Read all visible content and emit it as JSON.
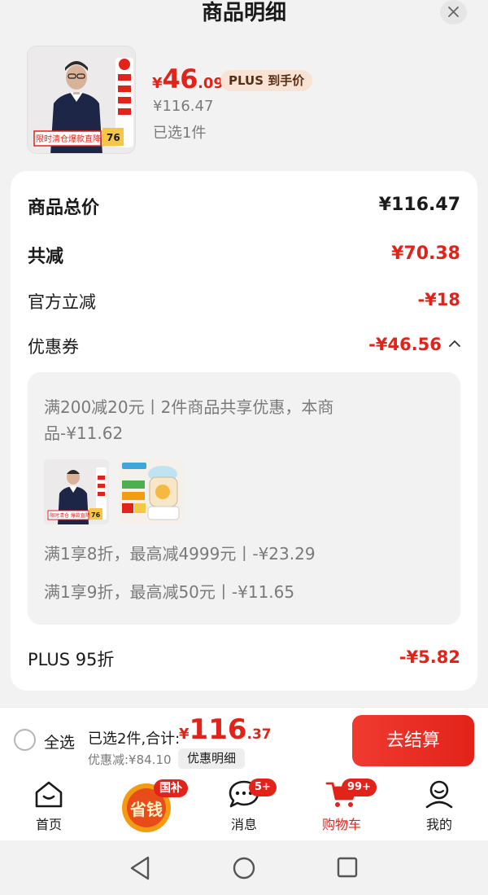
{
  "header": {
    "title": "商品明细"
  },
  "product": {
    "price_yen": "¥",
    "price_int": "46",
    "price_dec": ".09",
    "plus_badge": "PLUS 到手价",
    "original_price": "¥116.47",
    "selected_count": "已选1件",
    "thumb_label_left": "限时清仓",
    "thumb_label_right": "爆款直降",
    "thumb_number": "76"
  },
  "breakdown": {
    "total_label": "商品总价",
    "total_value": "¥116.47",
    "reduce_label": "共减",
    "reduce_value": "¥70.38",
    "official_label": "官方立减",
    "official_value": "-¥18",
    "coupon_label": "优惠券",
    "coupon_value": "-¥46.56",
    "coupon_detail": {
      "line1": "满200减20元丨2件商品共享优惠，本商",
      "line2": "品-¥11.62",
      "line3": "满1享8折，最高减4999元丨-¥23.29",
      "line4": "满1享9折，最高减50元丨-¥11.65",
      "mini_thumb_number": "76",
      "mini_thumb_label": "限时清仓 爆款直降"
    },
    "plus_label": "PLUS 95折",
    "plus_value": "-¥5.82"
  },
  "bottom_bar": {
    "select_all": "全选",
    "total_label": "已选2件,合计:",
    "total_yen": "¥",
    "total_int": "116",
    "total_dec": ".37",
    "discount_label": "优惠减:¥84.10",
    "detail_button": "优惠明细",
    "checkout_button": "去结算"
  },
  "tabbar": {
    "home": "首页",
    "save_money": "省钱",
    "save_badge": "国补",
    "messages": "消息",
    "messages_badge": "5+",
    "cart": "购物车",
    "cart_badge": "99+",
    "mine": "我的"
  },
  "colors": {
    "accent_red": "#e2231a",
    "plus_badge_bg": "#f9e3d4",
    "card_bg": "#ffffff",
    "page_bg": "#f2f2f2"
  }
}
